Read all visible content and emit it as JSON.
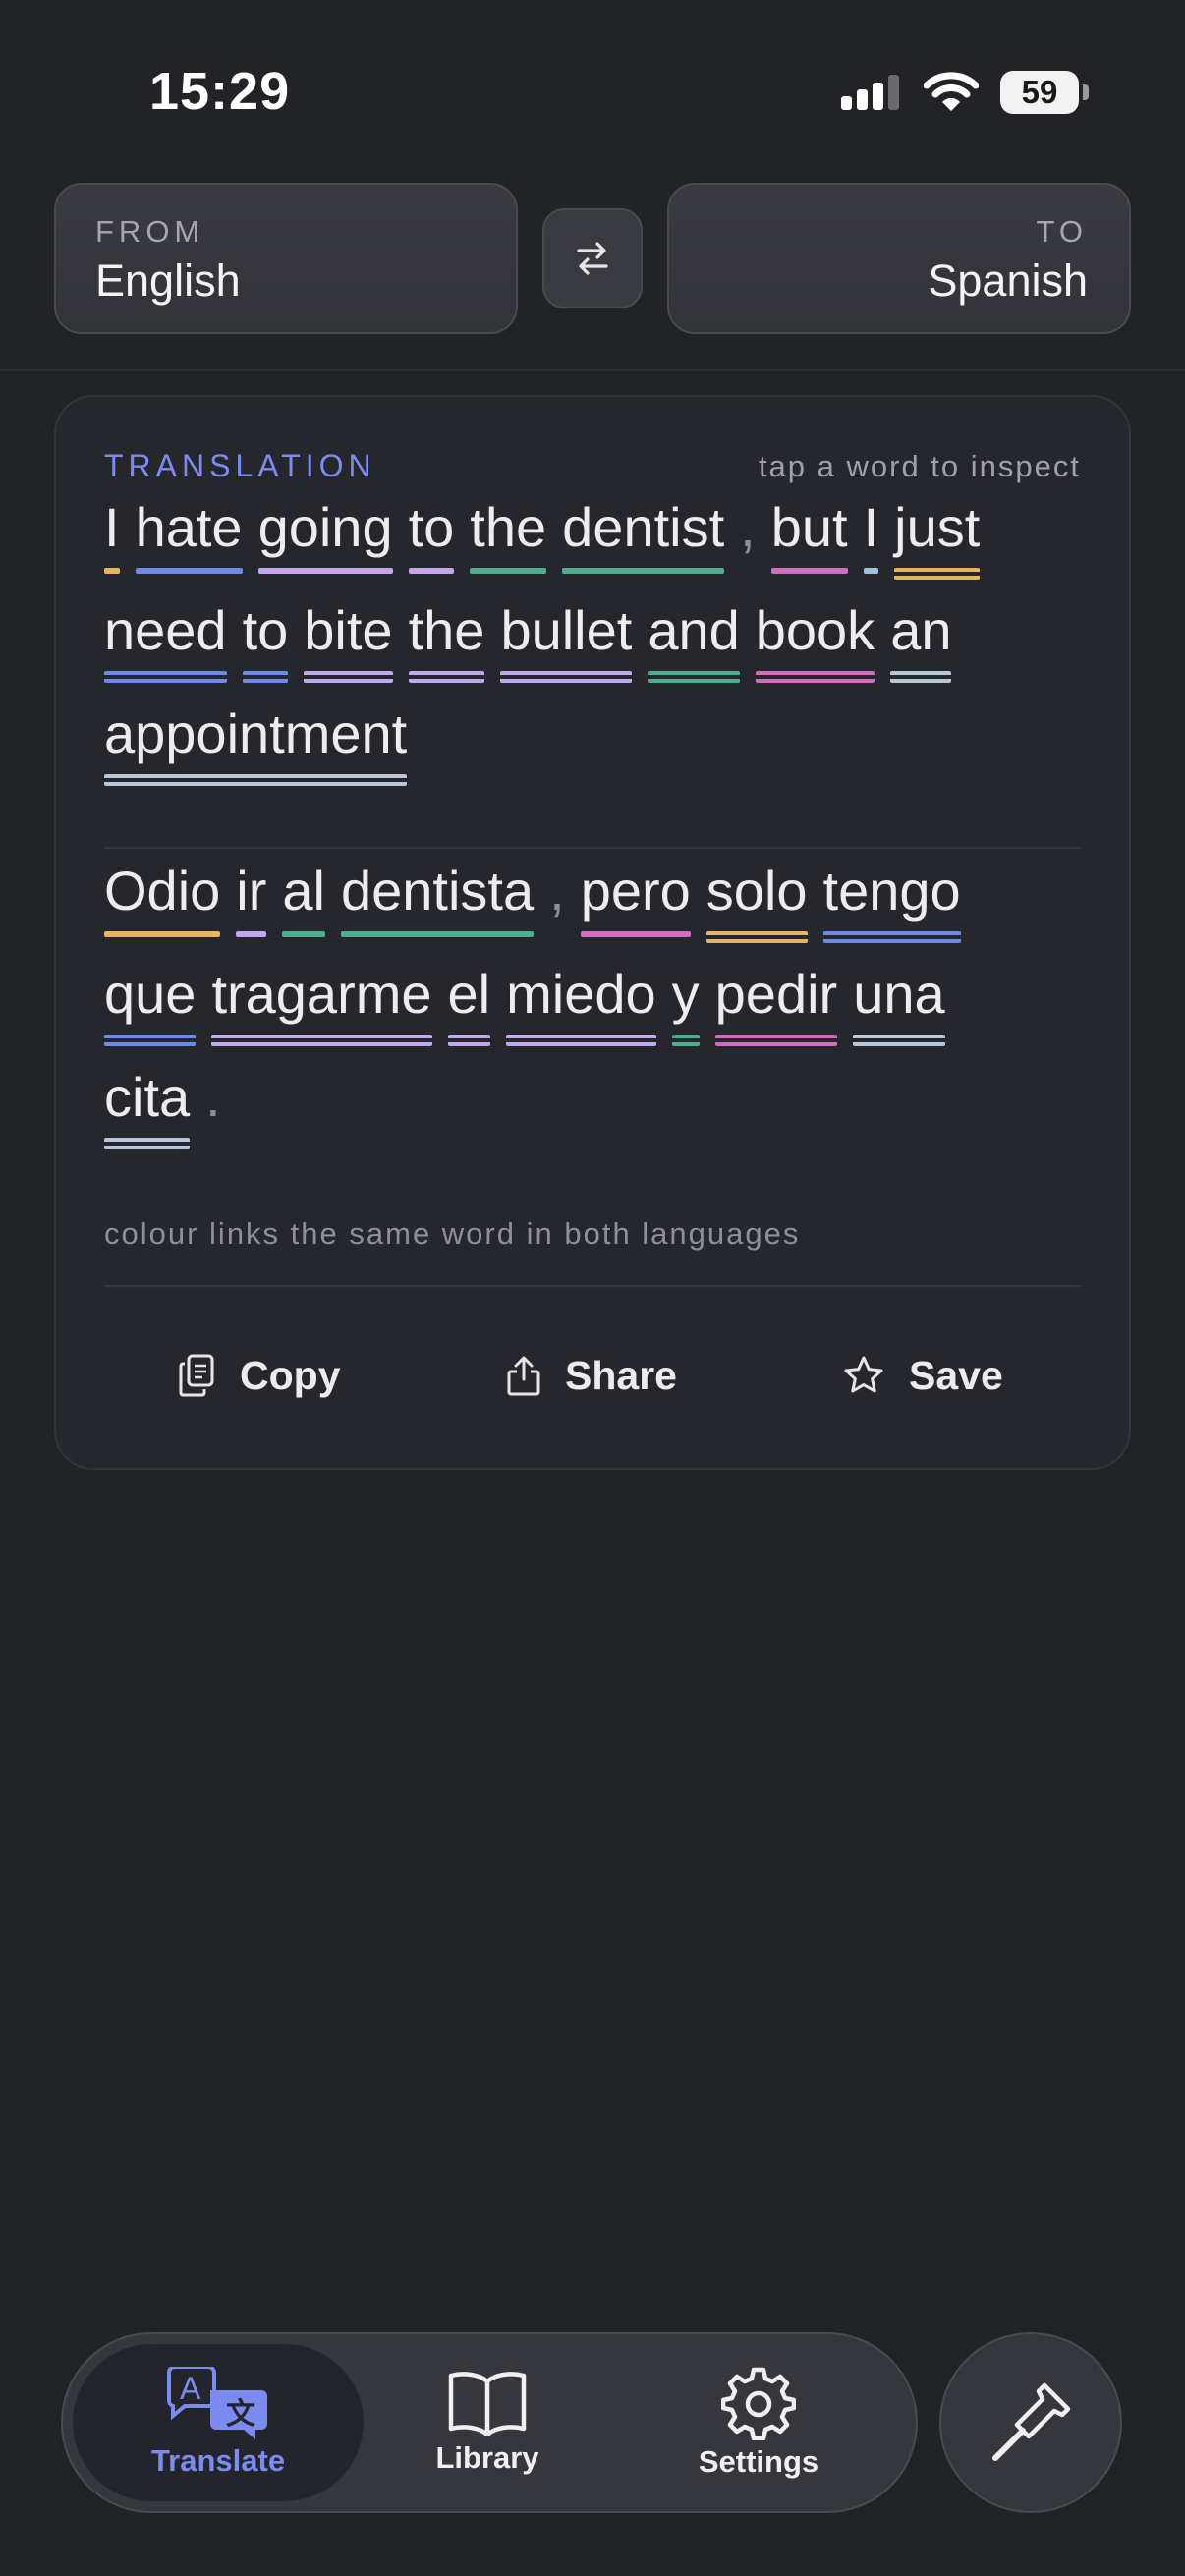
{
  "status": {
    "time": "15:29",
    "battery": "59"
  },
  "lang": {
    "from_caption": "FROM",
    "from_value": "English",
    "to_caption": "TO",
    "to_value": "Spanish"
  },
  "card": {
    "label": "TRANSLATION",
    "hint": "tap a word to inspect",
    "source_lines": [
      [
        {
          "t": "I",
          "c": "#E7B65C"
        },
        {
          "t": "hate",
          "c": "#6F8BEA"
        },
        {
          "t": "going",
          "c": "#C2A6EE"
        },
        {
          "t": "to",
          "c": "#C2A6EE"
        },
        {
          "t": "the",
          "c": "#4FAE92"
        },
        {
          "t": "dentist",
          "c": "#4FAE92"
        },
        {
          "t": ",",
          "p": true
        },
        {
          "t": "but",
          "c": "#D26DC0"
        },
        {
          "t": "I",
          "c": "#9CC3E0"
        },
        {
          "t": "just",
          "c": "#E7B65C",
          "d": true
        }
      ],
      [
        {
          "t": "need",
          "c": "#6F8BEA",
          "d": true
        },
        {
          "t": "to",
          "c": "#6F8BEA",
          "d": true
        },
        {
          "t": "bite",
          "c": "#C2A6EE",
          "d": true
        },
        {
          "t": "the",
          "c": "#C2A6EE",
          "d": true
        },
        {
          "t": "bullet",
          "c": "#C2A6EE",
          "d": true
        },
        {
          "t": "and",
          "c": "#4FAE92",
          "d": true
        },
        {
          "t": "book",
          "c": "#D26DC0",
          "d": true
        },
        {
          "t": "an",
          "c": "#B7C6D8",
          "d": true
        }
      ],
      [
        {
          "t": "appointment",
          "c": "#B7C6D8",
          "d": true
        }
      ]
    ],
    "target_lines": [
      [
        {
          "t": "Odio",
          "c": "#E7B65C"
        },
        {
          "t": "ir",
          "c": "#C2A6EE"
        },
        {
          "t": "al",
          "c": "#4FAE92"
        },
        {
          "t": "dentista",
          "c": "#4FAE92"
        },
        {
          "t": ",",
          "p": true
        },
        {
          "t": "pero",
          "c": "#D26DC0"
        },
        {
          "t": "solo",
          "c": "#E7B65C",
          "d": true
        },
        {
          "t": "tengo",
          "c": "#6F8BEA",
          "d": true
        }
      ],
      [
        {
          "t": "que",
          "c": "#6F8BEA",
          "d": true
        },
        {
          "t": "tragarme",
          "c": "#C2A6EE",
          "d": true
        },
        {
          "t": "el",
          "c": "#C2A6EE",
          "d": true
        },
        {
          "t": "miedo",
          "c": "#C2A6EE",
          "d": true
        },
        {
          "t": "y",
          "c": "#4FAE92",
          "d": true
        },
        {
          "t": "pedir",
          "c": "#D26DC0",
          "d": true
        },
        {
          "t": "una",
          "c": "#B7C6D8",
          "d": true
        }
      ],
      [
        {
          "t": "cita",
          "c": "#B7C6D8",
          "d": true
        },
        {
          "t": ".",
          "p": true
        }
      ]
    ],
    "legend_note": "colour links the same word in both languages",
    "actions": {
      "copy": "Copy",
      "share": "Share",
      "save": "Save"
    }
  },
  "tabs": {
    "translate": "Translate",
    "library": "Library",
    "settings": "Settings"
  },
  "colors": {
    "accent": "#7C8BF0",
    "background": "#222327",
    "card": "#26272C"
  }
}
